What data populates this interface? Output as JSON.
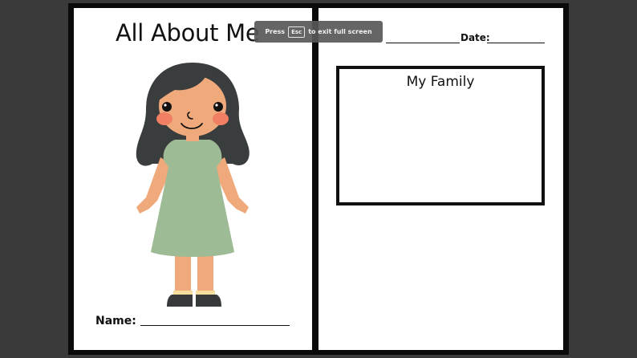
{
  "fullscreen_notice": {
    "press": "Press",
    "key": "Esc",
    "rest": "to exit full screen"
  },
  "left_page": {
    "title": "All About Me",
    "name_label": "Name:",
    "illustration": "girl-illustration",
    "colors": {
      "hair": "#3a3d3e",
      "skin": "#f0a97b",
      "cheeks": "#f07f63",
      "dress": "#9dbb94",
      "socks": "#f4dd9d",
      "shoes": "#363a3a"
    }
  },
  "right_page": {
    "date_label": "Date:",
    "family_title": "My Family"
  }
}
